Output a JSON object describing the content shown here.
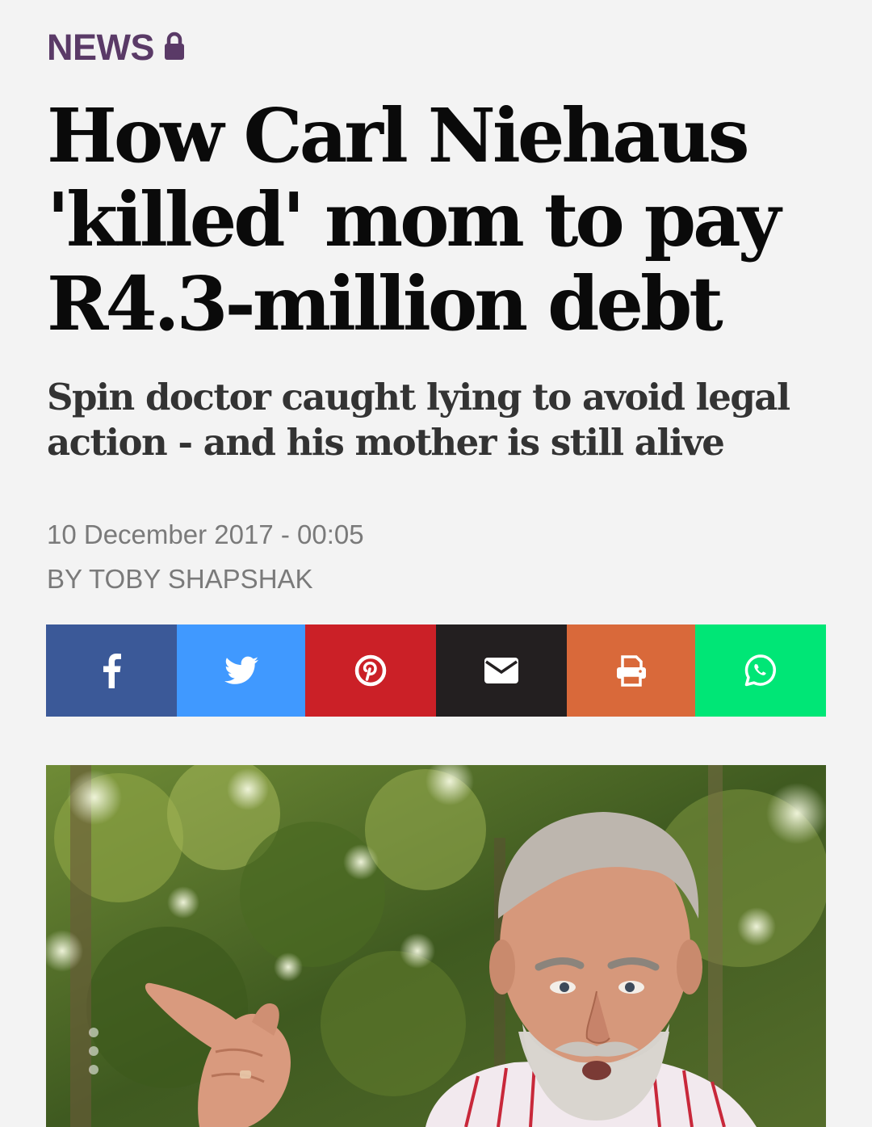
{
  "section": {
    "label": "NEWS",
    "icon": "lock-icon"
  },
  "article": {
    "headline": "How Carl Niehaus 'killed' mom to pay R4.3-million debt",
    "subheadline": "Spin doctor caught lying to avoid legal action - and his mother is still alive",
    "date": "10 December 2017 - 00:05",
    "byline": "BY TOBY SHAPSHAK"
  },
  "share": {
    "buttons": [
      {
        "name": "facebook-share-button",
        "icon": "facebook-icon",
        "color": "#3b5998"
      },
      {
        "name": "twitter-share-button",
        "icon": "twitter-icon",
        "color": "#4099ff"
      },
      {
        "name": "pinterest-share-button",
        "icon": "pinterest-icon",
        "color": "#cb2027"
      },
      {
        "name": "email-share-button",
        "icon": "envelope-icon",
        "color": "#231f20"
      },
      {
        "name": "print-share-button",
        "icon": "printer-icon",
        "color": "#d9693a"
      },
      {
        "name": "whatsapp-share-button",
        "icon": "whatsapp-icon",
        "color": "#00e676"
      }
    ]
  },
  "photo": {
    "icon": "article-photo"
  },
  "colors": {
    "section": "#5a3a67",
    "headline": "#0a0a0a",
    "subheadline": "#333333",
    "meta": "#7a7a7a",
    "background": "#f3f3f3"
  }
}
